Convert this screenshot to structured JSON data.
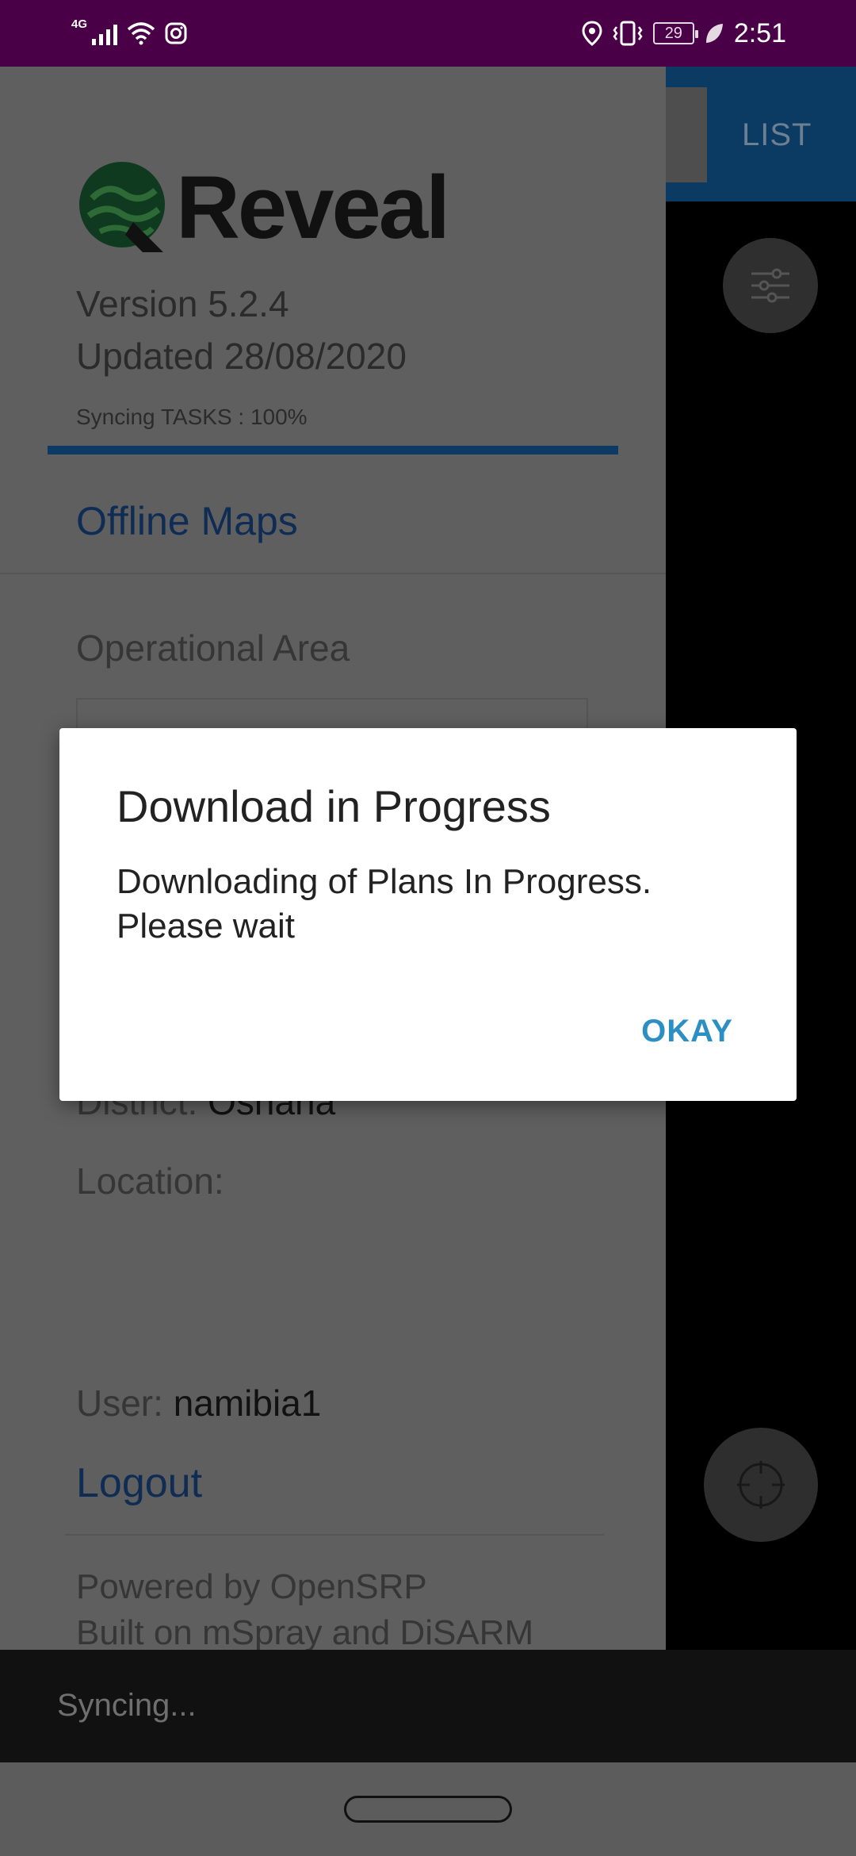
{
  "status_bar": {
    "network": "4G",
    "battery": "29",
    "time": "2:51"
  },
  "map": {
    "list_label": "LIST"
  },
  "drawer": {
    "logo_text": "Reveal",
    "version": "Version 5.2.4",
    "updated": "Updated 28/08/2020",
    "sync_status": "Syncing TASKS : 100%",
    "sync_progress_percent": 100,
    "offline_maps": "Offline Maps",
    "operational_area_label": "Operational Area",
    "district_label": "District: ",
    "district_value": "Oshana",
    "location_label": "Location:",
    "user_label": "User: ",
    "user_value": "namibia1",
    "logout": "Logout",
    "powered_by": "Powered by OpenSRP",
    "built_on": "Built on mSpray and DiSARM"
  },
  "snackbar": {
    "text": "Syncing..."
  },
  "dialog": {
    "title": "Download in Progress",
    "message": "Downloading of Plans In Progress. Please wait",
    "ok_label": "OKAY"
  },
  "colors": {
    "status_bar": "#4a0046",
    "accent_link": "#0f2c54",
    "dialog_button": "#2b8fc4"
  },
  "icons": [
    "signal-icon",
    "wifi-icon",
    "instagram-icon",
    "location-pin-icon",
    "vibrate-icon",
    "battery-icon",
    "leaf-icon",
    "filter-icon",
    "my-location-icon"
  ]
}
